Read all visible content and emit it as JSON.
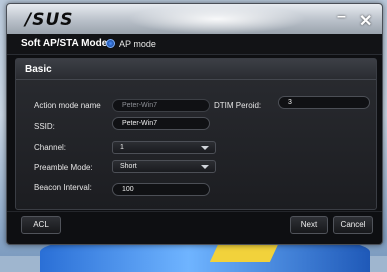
{
  "window": {
    "logo": "/SUS",
    "minimize_glyph": "–",
    "close_glyph": "✕"
  },
  "mode": {
    "title": "Soft AP/STA Mode",
    "option_label": "AP mode",
    "option_selected": true
  },
  "panel": {
    "title": "Basic",
    "fields": {
      "action_mode_label": "Action mode name",
      "action_mode_value": "Peter-Win7",
      "ssid_label": "SSID:",
      "ssid_value": "Peter-Win7",
      "channel_label": "Channel:",
      "channel_value": "1",
      "preamble_label": "Preamble Mode:",
      "preamble_value": "Short",
      "beacon_label": "Beacon Interval:",
      "beacon_value": "100",
      "dtim_label": "DTIM Peroid:",
      "dtim_value": "3"
    }
  },
  "buttons": {
    "acl": "ACL",
    "next": "Next",
    "cancel": "Cancel"
  },
  "colors": {
    "accent": "#4a90ff",
    "window_bg": "#0e0f12",
    "panel_bg": "#2a2c31"
  }
}
